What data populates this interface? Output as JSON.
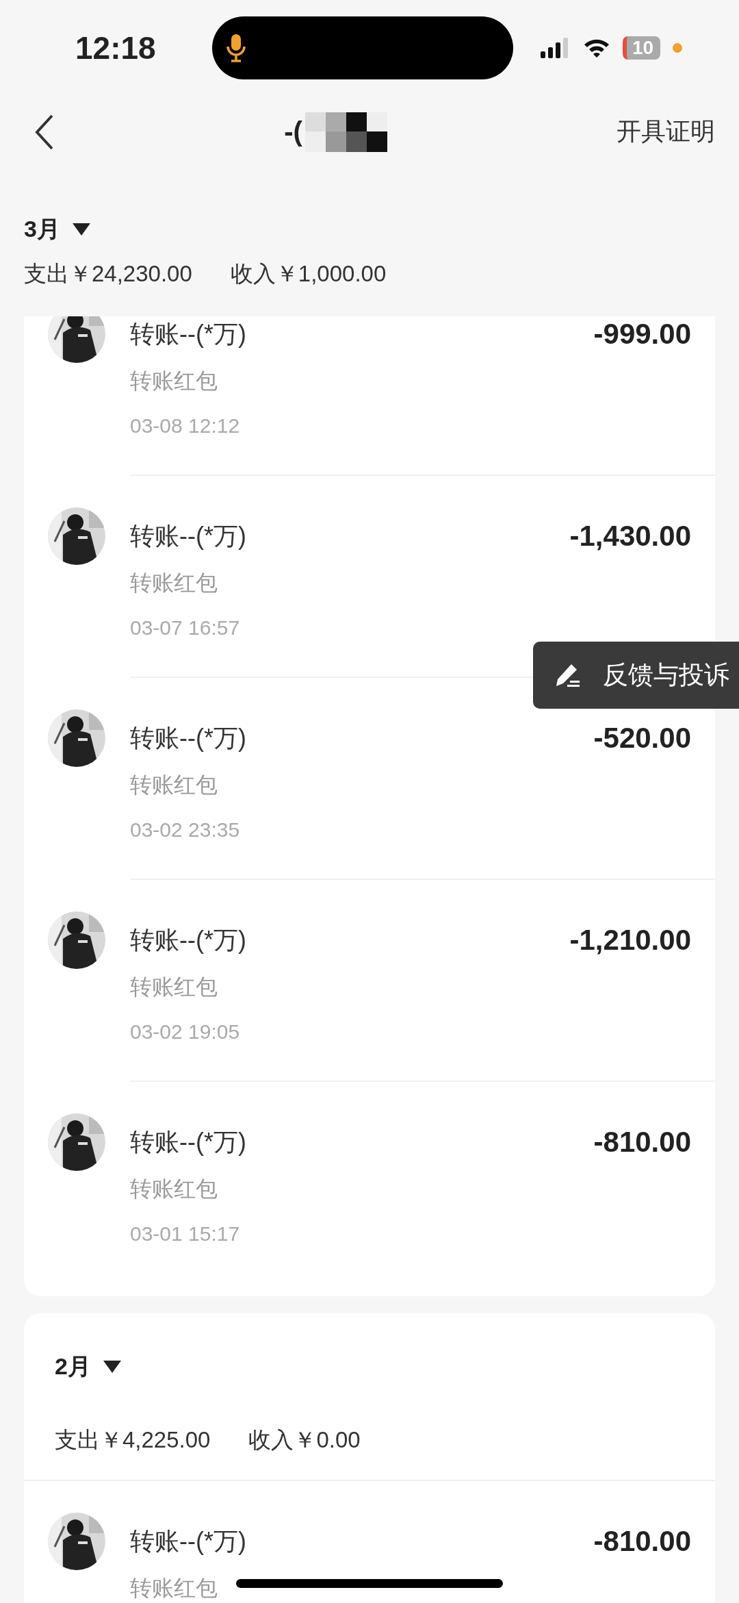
{
  "status_bar": {
    "time": "12:18",
    "battery": "10"
  },
  "nav": {
    "title": "-(",
    "action": "开具证明"
  },
  "months": [
    {
      "month": "3月",
      "expense": "支出￥24,230.00",
      "income": "收入￥1,000.00",
      "transactions": [
        {
          "name": "转账--(*万)",
          "category": "转账红包",
          "time": "03-08 12:12",
          "amount": "-999.00"
        },
        {
          "name": "转账--(*万)",
          "category": "转账红包",
          "time": "03-07 16:57",
          "amount": "-1,430.00"
        },
        {
          "name": "转账--(*万)",
          "category": "转账红包",
          "time": "03-02 23:35",
          "amount": "-520.00"
        },
        {
          "name": "转账--(*万)",
          "category": "转账红包",
          "time": "03-02 19:05",
          "amount": "-1,210.00"
        },
        {
          "name": "转账--(*万)",
          "category": "转账红包",
          "time": "03-01 15:17",
          "amount": "-810.00"
        }
      ]
    },
    {
      "month": "2月",
      "expense": "支出￥4,225.00",
      "income": "收入￥0.00",
      "transactions": [
        {
          "name": "转账--(*万)",
          "category": "转账红包",
          "amount": "-810.00"
        }
      ]
    }
  ],
  "feedback": {
    "label": "反馈与投诉"
  }
}
